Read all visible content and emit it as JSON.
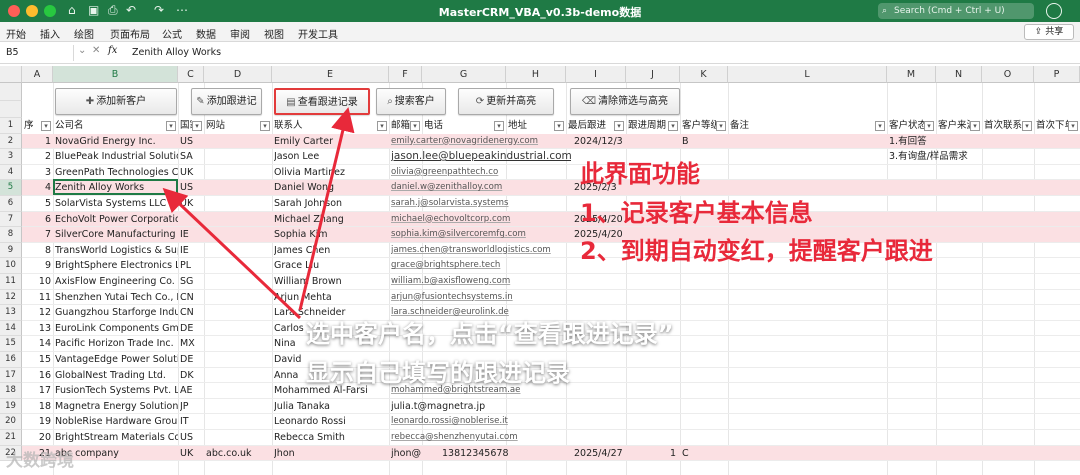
{
  "window": {
    "title": "MasterCRM_VBA_v0.3b-demo数据",
    "search_placeholder": "Search (Cmd + Ctrl + U)"
  },
  "ribbon": {
    "tabs": [
      "开始",
      "插入",
      "绘图",
      "页面布局",
      "公式",
      "数据",
      "审阅",
      "视图",
      "开发工具"
    ],
    "share_label": "共享"
  },
  "formula_bar": {
    "name_box": "B5",
    "fx_label": "fx",
    "value": "Zenith Alloy Works"
  },
  "columns": [
    "A",
    "B",
    "C",
    "D",
    "E",
    "F",
    "G",
    "H",
    "I",
    "J",
    "K",
    "L",
    "M",
    "N",
    "O",
    "P"
  ],
  "buttons": {
    "add_customer": "添加新客户",
    "add_followup": "添加跟进记",
    "view_followup": "查看跟进记录",
    "search_customer": "搜索客户",
    "update_highlight": "更新并高亮",
    "clear_filter": "清除筛选与高亮"
  },
  "headers": [
    "序",
    "公司名",
    "国家",
    "网站",
    "联系人",
    "邮箱",
    "电话",
    "地址",
    "最后跟进",
    "跟进周期",
    "客户等级",
    "备注",
    "客户状态",
    "客户来源",
    "首次联系",
    "首次下单"
  ],
  "rows": [
    {
      "seq": "1",
      "company": "NovaGrid Energy Inc.",
      "country": "US",
      "website": "",
      "contact": "Emily Carter",
      "email": "emily.carter@novagridenergy.com",
      "phone": "",
      "last": "2024/12/3",
      "cycle": "",
      "level": "B",
      "status": "1.有回答",
      "source": ""
    },
    {
      "seq": "2",
      "company": "BluePeak Industrial Solutions",
      "country": "SA",
      "website": "",
      "contact": "Jason Lee",
      "email": "jason.lee@bluepeakindustrial.com",
      "phone": "",
      "last": "",
      "cycle": "",
      "level": "",
      "status": "3.有询盘/样品需求",
      "source": ""
    },
    {
      "seq": "3",
      "company": "GreenPath Technologies Co.",
      "country": "UK",
      "website": "",
      "contact": "Olivia Martinez",
      "email": "olivia@greenpathtech.co",
      "phone": "",
      "last": "",
      "cycle": "",
      "level": "",
      "status": "",
      "source": ""
    },
    {
      "seq": "4",
      "company": "Zenith Alloy Works",
      "country": "US",
      "website": "",
      "contact": "Daniel Wong",
      "email": "daniel.w@zenithalloy.com",
      "phone": "",
      "last": "2025/2/3",
      "cycle": "",
      "level": "",
      "status": "",
      "source": ""
    },
    {
      "seq": "5",
      "company": "SolarVista Systems LLC",
      "country": "UK",
      "website": "",
      "contact": "Sarah Johnson",
      "email": "sarah.j@solarvista.systems",
      "phone": "",
      "last": "",
      "cycle": "",
      "level": "",
      "status": "",
      "source": ""
    },
    {
      "seq": "6",
      "company": "EchoVolt Power Corporation",
      "country": "",
      "website": "",
      "contact": "Michael Zhang",
      "email": "michael@echovoltcorp.com",
      "phone": "",
      "last": "2025/4/20",
      "cycle": "",
      "level": "",
      "status": "",
      "source": ""
    },
    {
      "seq": "7",
      "company": "SilverCore Manufacturing",
      "country": "IE",
      "website": "",
      "contact": "Sophia Kim",
      "email": "sophia.kim@silvercoremfg.com",
      "phone": "",
      "last": "2025/4/20",
      "cycle": "",
      "level": "",
      "status": "",
      "source": ""
    },
    {
      "seq": "8",
      "company": "TransWorld Logistics & Supply",
      "country": "IE",
      "website": "",
      "contact": "James Chen",
      "email": "james.chen@transworldlogistics.com",
      "phone": "",
      "last": "",
      "cycle": "",
      "level": "",
      "status": "",
      "source": ""
    },
    {
      "seq": "9",
      "company": "BrightSphere Electronics Ltd",
      "country": "PL",
      "website": "",
      "contact": "Grace Liu",
      "email": "grace@brightsphere.tech",
      "phone": "",
      "last": "",
      "cycle": "",
      "level": "",
      "status": "",
      "source": ""
    },
    {
      "seq": "10",
      "company": "AxisFlow Engineering Co.",
      "country": "SG",
      "website": "",
      "contact": "William Brown",
      "email": "william.b@axisfloweng.com",
      "phone": "",
      "last": "",
      "cycle": "",
      "level": "",
      "status": "",
      "source": ""
    },
    {
      "seq": "11",
      "company": "Shenzhen Yutai Tech Co., Ltd",
      "country": "CN",
      "website": "",
      "contact": "Arjun Mehta",
      "email": "arjun@fusiontechsystems.in",
      "phone": "",
      "last": "",
      "cycle": "",
      "level": "",
      "status": "",
      "source": ""
    },
    {
      "seq": "12",
      "company": "Guangzhou Starforge Industries",
      "country": "CN",
      "website": "",
      "contact": "Lara Schneider",
      "email": "lara.schneider@eurolink.de",
      "phone": "",
      "last": "",
      "cycle": "",
      "level": "",
      "status": "",
      "source": ""
    },
    {
      "seq": "13",
      "company": "EuroLink Components GmbH",
      "country": "DE",
      "website": "",
      "contact": "Carlos",
      "email": "",
      "phone": "",
      "last": "",
      "cycle": "",
      "level": "",
      "status": "",
      "source": ""
    },
    {
      "seq": "14",
      "company": "Pacific Horizon Trade Inc.",
      "country": "MX",
      "website": "",
      "contact": "Nina",
      "email": "",
      "phone": "",
      "last": "",
      "cycle": "",
      "level": "",
      "status": "",
      "source": ""
    },
    {
      "seq": "15",
      "company": "VantageEdge Power Solutions",
      "country": "DE",
      "website": "",
      "contact": "David",
      "email": "",
      "phone": "",
      "last": "",
      "cycle": "",
      "level": "",
      "status": "",
      "source": ""
    },
    {
      "seq": "16",
      "company": "GlobalNest Trading Ltd.",
      "country": "DK",
      "website": "",
      "contact": "Anna",
      "email": "",
      "phone": "",
      "last": "",
      "cycle": "",
      "level": "",
      "status": "",
      "source": ""
    },
    {
      "seq": "17",
      "company": "FusionTech Systems Pvt. Ltd.",
      "country": "AE",
      "website": "",
      "contact": "Mohammed Al-Farsi",
      "email": "mohammed@brightstream.ae",
      "phone": "",
      "last": "",
      "cycle": "",
      "level": "",
      "status": "",
      "source": ""
    },
    {
      "seq": "18",
      "company": "Magnetra Energy Solutions",
      "country": "JP",
      "website": "",
      "contact": "Julia Tanaka",
      "email": "julia.t@magnetra.jp",
      "phone": "",
      "last": "",
      "cycle": "",
      "level": "",
      "status": "",
      "source": ""
    },
    {
      "seq": "19",
      "company": "NobleRise Hardware Group",
      "country": "IT",
      "website": "",
      "contact": "Leonardo Rossi",
      "email": "leonardo.rossi@noblerise.it",
      "phone": "",
      "last": "",
      "cycle": "",
      "level": "",
      "status": "",
      "source": ""
    },
    {
      "seq": "20",
      "company": "BrightStream Materials Co.",
      "country": "US",
      "website": "",
      "contact": "Rebecca Smith",
      "email": "rebecca@shenzhenyutai.com",
      "phone": "",
      "last": "",
      "cycle": "",
      "level": "",
      "status": "",
      "source": ""
    },
    {
      "seq": "21",
      "company": "abc company",
      "country": "UK",
      "website": "abc.co.uk",
      "contact": "Jhon",
      "email": "jhon@",
      "phone": "13812345678",
      "last": "2025/4/27",
      "cycle": "1",
      "level": "C",
      "status": "",
      "source": ""
    }
  ],
  "annotations": {
    "feature_title": "此界面功能",
    "feature_1": "1、记录客户基本信息",
    "feature_2": "2、到期自动变红，提醒客户跟进",
    "instruction_1": "选中客户名，点击“查看跟进记录”",
    "instruction_2": "显示自己填写的跟进记录",
    "watermark": "大数跨境"
  },
  "colors": {
    "title_bar": "#1f7a45",
    "overdue_row": "#fbe0e3",
    "annotation_red": "#e8293a"
  }
}
